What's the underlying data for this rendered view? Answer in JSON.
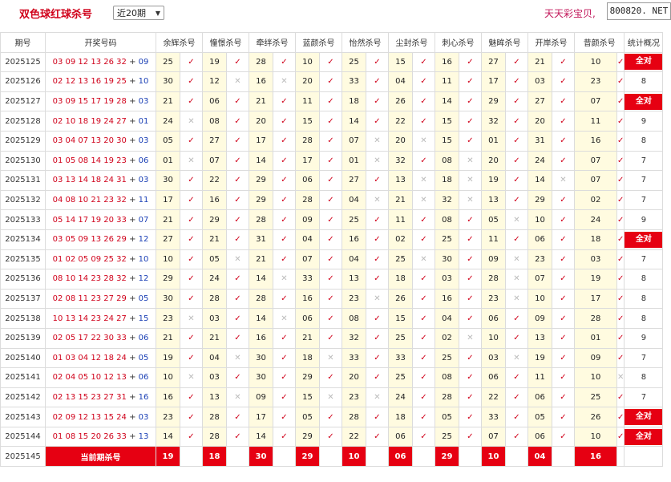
{
  "header": {
    "title": "双色球红球杀号",
    "select_value": "近20期",
    "brand": "天天彩宝贝,",
    "watermark": "800820. NET"
  },
  "columns": [
    "期号",
    "开奖号码",
    "余辉杀号",
    "憧憬杀号",
    "牵绊杀号",
    "蓝颜杀号",
    "怡然杀号",
    "尘封杀号",
    "刺心杀号",
    "魅眸杀号",
    "开岸杀号",
    "昔颜杀号",
    "统计概况"
  ],
  "rows": [
    {
      "period": "2025125",
      "red": "03 09 12 13 26 32",
      "blue": "09",
      "kills": [
        "25",
        "19",
        "28",
        "10",
        "25",
        "15",
        "16",
        "27",
        "21",
        "10"
      ],
      "hits": [
        1,
        1,
        1,
        1,
        1,
        1,
        1,
        1,
        1,
        1
      ],
      "stat": "全对"
    },
    {
      "period": "2025126",
      "red": "02 12 13 16 19 25",
      "blue": "10",
      "kills": [
        "30",
        "12",
        "16",
        "20",
        "33",
        "04",
        "11",
        "17",
        "03",
        "23"
      ],
      "hits": [
        1,
        0,
        0,
        1,
        1,
        1,
        1,
        1,
        1,
        1
      ],
      "stat": "8"
    },
    {
      "period": "2025127",
      "red": "03 09 15 17 19 28",
      "blue": "03",
      "kills": [
        "21",
        "06",
        "21",
        "11",
        "18",
        "26",
        "14",
        "29",
        "27",
        "07"
      ],
      "hits": [
        1,
        1,
        1,
        1,
        1,
        1,
        1,
        1,
        1,
        1
      ],
      "stat": "全对"
    },
    {
      "period": "2025128",
      "red": "02 10 18 19 24 27",
      "blue": "01",
      "kills": [
        "24",
        "08",
        "20",
        "15",
        "14",
        "22",
        "15",
        "32",
        "20",
        "11"
      ],
      "hits": [
        0,
        1,
        1,
        1,
        1,
        1,
        1,
        1,
        1,
        1
      ],
      "stat": "9"
    },
    {
      "period": "2025129",
      "red": "03 04 07 13 20 30",
      "blue": "03",
      "kills": [
        "05",
        "27",
        "17",
        "28",
        "07",
        "20",
        "15",
        "01",
        "31",
        "16"
      ],
      "hits": [
        1,
        1,
        1,
        1,
        0,
        0,
        1,
        1,
        1,
        1
      ],
      "stat": "8"
    },
    {
      "period": "2025130",
      "red": "01 05 08 14 19 23",
      "blue": "06",
      "kills": [
        "01",
        "07",
        "14",
        "17",
        "01",
        "32",
        "08",
        "20",
        "24",
        "07"
      ],
      "hits": [
        0,
        1,
        1,
        1,
        0,
        1,
        0,
        1,
        1,
        1
      ],
      "stat": "7"
    },
    {
      "period": "2025131",
      "red": "03 13 14 18 24 31",
      "blue": "03",
      "kills": [
        "30",
        "22",
        "29",
        "06",
        "27",
        "13",
        "18",
        "19",
        "14",
        "07"
      ],
      "hits": [
        1,
        1,
        1,
        1,
        1,
        0,
        0,
        1,
        0,
        1
      ],
      "stat": "7"
    },
    {
      "period": "2025132",
      "red": "04 08 10 21 23 32",
      "blue": "11",
      "kills": [
        "17",
        "16",
        "29",
        "28",
        "04",
        "21",
        "32",
        "13",
        "29",
        "02"
      ],
      "hits": [
        1,
        1,
        1,
        1,
        0,
        0,
        0,
        1,
        1,
        1
      ],
      "stat": "7"
    },
    {
      "period": "2025133",
      "red": "05 14 17 19 20 33",
      "blue": "07",
      "kills": [
        "21",
        "29",
        "28",
        "09",
        "25",
        "11",
        "08",
        "05",
        "10",
        "24"
      ],
      "hits": [
        1,
        1,
        1,
        1,
        1,
        1,
        1,
        0,
        1,
        1
      ],
      "stat": "9"
    },
    {
      "period": "2025134",
      "red": "03 05 09 13 26 29",
      "blue": "12",
      "kills": [
        "27",
        "21",
        "31",
        "04",
        "16",
        "02",
        "25",
        "11",
        "06",
        "18"
      ],
      "hits": [
        1,
        1,
        1,
        1,
        1,
        1,
        1,
        1,
        1,
        1
      ],
      "stat": "全对"
    },
    {
      "period": "2025135",
      "red": "01 02 05 09 25 32",
      "blue": "10",
      "kills": [
        "10",
        "05",
        "21",
        "07",
        "04",
        "25",
        "30",
        "09",
        "23",
        "03"
      ],
      "hits": [
        1,
        0,
        1,
        1,
        1,
        0,
        1,
        0,
        1,
        1
      ],
      "stat": "7"
    },
    {
      "period": "2025136",
      "red": "08 10 14 23 28 32",
      "blue": "12",
      "kills": [
        "29",
        "24",
        "14",
        "33",
        "13",
        "18",
        "03",
        "28",
        "07",
        "19"
      ],
      "hits": [
        1,
        1,
        0,
        1,
        1,
        1,
        1,
        0,
        1,
        1
      ],
      "stat": "8"
    },
    {
      "period": "2025137",
      "red": "02 08 11 23 27 29",
      "blue": "05",
      "kills": [
        "30",
        "28",
        "28",
        "16",
        "23",
        "26",
        "16",
        "23",
        "10",
        "17"
      ],
      "hits": [
        1,
        1,
        1,
        1,
        0,
        1,
        1,
        0,
        1,
        1
      ],
      "stat": "8"
    },
    {
      "period": "2025138",
      "red": "10 13 14 23 24 27",
      "blue": "15",
      "kills": [
        "23",
        "03",
        "14",
        "06",
        "08",
        "15",
        "04",
        "06",
        "09",
        "28"
      ],
      "hits": [
        0,
        1,
        0,
        1,
        1,
        1,
        1,
        1,
        1,
        1
      ],
      "stat": "8"
    },
    {
      "period": "2025139",
      "red": "02 05 17 22 30 33",
      "blue": "06",
      "kills": [
        "21",
        "21",
        "16",
        "21",
        "32",
        "25",
        "02",
        "10",
        "13",
        "01"
      ],
      "hits": [
        1,
        1,
        1,
        1,
        1,
        1,
        0,
        1,
        1,
        1
      ],
      "stat": "9"
    },
    {
      "period": "2025140",
      "red": "01 03 04 12 18 24",
      "blue": "05",
      "kills": [
        "19",
        "04",
        "30",
        "18",
        "33",
        "33",
        "25",
        "03",
        "19",
        "09"
      ],
      "hits": [
        1,
        0,
        1,
        0,
        1,
        1,
        1,
        0,
        1,
        1
      ],
      "stat": "7"
    },
    {
      "period": "2025141",
      "red": "02 04 05 10 12 13",
      "blue": "06",
      "kills": [
        "10",
        "03",
        "30",
        "29",
        "20",
        "25",
        "08",
        "06",
        "11",
        "10"
      ],
      "hits": [
        0,
        1,
        1,
        1,
        1,
        1,
        1,
        1,
        1,
        0
      ],
      "stat": "8"
    },
    {
      "period": "2025142",
      "red": "02 13 15 23 27 31",
      "blue": "16",
      "kills": [
        "16",
        "13",
        "09",
        "15",
        "23",
        "24",
        "28",
        "22",
        "06",
        "25"
      ],
      "hits": [
        1,
        0,
        1,
        0,
        0,
        1,
        1,
        1,
        1,
        1
      ],
      "stat": "7"
    },
    {
      "period": "2025143",
      "red": "02 09 12 13 15 24",
      "blue": "03",
      "kills": [
        "23",
        "28",
        "17",
        "05",
        "28",
        "18",
        "05",
        "33",
        "05",
        "26"
      ],
      "hits": [
        1,
        1,
        1,
        1,
        1,
        1,
        1,
        1,
        1,
        1
      ],
      "stat": "全对"
    },
    {
      "period": "2025144",
      "red": "01 08 15 20 26 33",
      "blue": "13",
      "kills": [
        "14",
        "28",
        "14",
        "29",
        "22",
        "06",
        "25",
        "07",
        "06",
        "10"
      ],
      "hits": [
        1,
        1,
        1,
        1,
        1,
        1,
        1,
        1,
        1,
        1
      ],
      "stat": "全对"
    }
  ],
  "current": {
    "period": "2025145",
    "label": "当前期杀号",
    "kills": [
      "19",
      "18",
      "30",
      "29",
      "10",
      "06",
      "29",
      "10",
      "04",
      "16"
    ]
  },
  "symbols": {
    "hit": "✓",
    "miss": "✕",
    "plus": "+"
  },
  "colors": {
    "red": "#d0021b",
    "blue": "#1a3fb5",
    "badge": "#e60012",
    "highlight": "#fffbe0",
    "miss": "#bbbbbb"
  }
}
